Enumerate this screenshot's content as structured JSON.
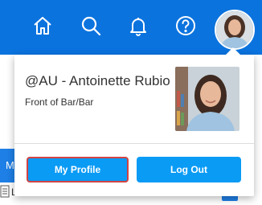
{
  "topbar": {
    "icons": [
      "home-icon",
      "search-icon",
      "bell-icon",
      "help-icon"
    ],
    "color": "#0b73de"
  },
  "user": {
    "name": "@AU - Antoinette Rubio",
    "role": "Front of Bar/Bar"
  },
  "buttons": {
    "profile_label": "My Profile",
    "logout_label": "Log Out",
    "color": "#0a9bf5",
    "focus_outline_color": "#d14343"
  },
  "background": {
    "left_tab_letter": "M",
    "row_text": "L"
  }
}
